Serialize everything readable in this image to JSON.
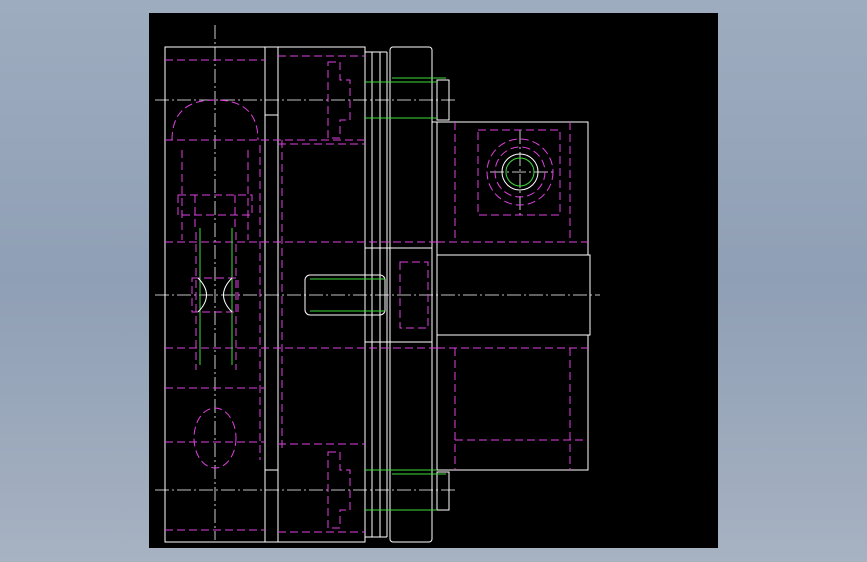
{
  "viewport": {
    "background": "#97a6ba",
    "canvas_background": "#000000"
  },
  "drawing": {
    "colors": {
      "outline": "#ffffff",
      "hidden": "#e040e0",
      "thread": "#3cdc3c",
      "center": "#ffffff"
    },
    "linetypes": {
      "outline": "continuous",
      "hidden": "dashed",
      "center": "dash-dot"
    }
  }
}
